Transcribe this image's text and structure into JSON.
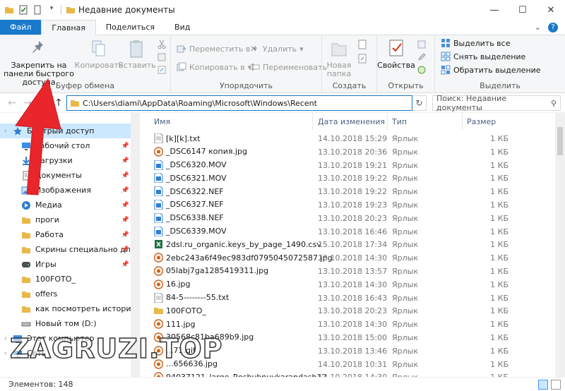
{
  "window": {
    "title": "Недавние документы",
    "minimize": "—",
    "maximize": "☐",
    "close": "✕"
  },
  "tabs": [
    {
      "label": "Файл"
    },
    {
      "label": "Главная"
    },
    {
      "label": "Поделиться"
    },
    {
      "label": "Вид"
    }
  ],
  "ribbon": {
    "clipboard": {
      "label": "Буфер обмена",
      "pin": "Закрепить на панели быстрого доступа",
      "copy": "Копировать",
      "paste": "Вставить"
    },
    "organize": {
      "label": "Упорядочить",
      "move_to": "Переместить в",
      "copy_to": "Копировать в",
      "delete": "Удалить",
      "rename": "Переименовать"
    },
    "create": {
      "label": "Создать",
      "new_folder": "Новая папка"
    },
    "open": {
      "label": "Открыть",
      "properties": "Свойства"
    },
    "select": {
      "label": "Выделить",
      "select_all": "Выделить все",
      "select_none": "Снять выделение",
      "invert": "Обратить выделение"
    }
  },
  "address": {
    "path": "C:\\Users\\diami\\AppData\\Roaming\\Microsoft\\Windows\\Recent",
    "search_placeholder": "Поиск: Недавние документы"
  },
  "nav": [
    {
      "label": "Быстрый доступ",
      "icon": "star-icon",
      "head": true,
      "selected": true
    },
    {
      "label": "Рабочий стол",
      "icon": "desktop-icon",
      "pinned": true
    },
    {
      "label": "Загрузки",
      "icon": "download-icon",
      "pinned": true
    },
    {
      "label": "Документы",
      "icon": "documents-icon",
      "pinned": true
    },
    {
      "label": "Изображения",
      "icon": "pictures-icon",
      "pinned": true
    },
    {
      "label": "Медиа",
      "icon": "media-icon",
      "pinned": true
    },
    {
      "label": "проги",
      "icon": "folder-icon",
      "pinned": true
    },
    {
      "label": "Работа",
      "icon": "folder-icon",
      "pinned": true
    },
    {
      "label": "Скрины специально для",
      "icon": "folder-icon",
      "pinned": true
    },
    {
      "label": "Игры",
      "icon": "games-icon",
      "pinned": true
    },
    {
      "label": "100FOTO_",
      "icon": "folder-icon"
    },
    {
      "label": "offers",
      "icon": "folder-icon"
    },
    {
      "label": "как посмотреть историю на",
      "icon": "folder-icon"
    },
    {
      "label": "Новый том (D:)",
      "icon": "drive-icon"
    },
    {
      "label": "Этот компьютер",
      "icon": "computer-icon",
      "head": true
    },
    {
      "label": "Сеть",
      "icon": "network-icon",
      "head": true
    }
  ],
  "columns": {
    "name": "Имя",
    "date": "Дата изменения",
    "type": "Тип",
    "size": "Размер"
  },
  "files": [
    {
      "name": "[k][k].txt",
      "date": "14.10.2018 15:29",
      "type": "Ярлык",
      "size": "1 КБ",
      "icon": "text"
    },
    {
      "name": "_DSC6147 копия.jpg",
      "date": "13.10.2018 20:36",
      "type": "Ярлык",
      "size": "1 КБ",
      "icon": "image"
    },
    {
      "name": "_DSC6320.MOV",
      "date": "13.10.2018 19:21",
      "type": "Ярлык",
      "size": "1 КБ",
      "icon": "media"
    },
    {
      "name": "_DSC6321.MOV",
      "date": "13.10.2018 19:22",
      "type": "Ярлык",
      "size": "1 КБ",
      "icon": "media"
    },
    {
      "name": "_DSC6322.NEF",
      "date": "13.10.2018 19:22",
      "type": "Ярлык",
      "size": "1 КБ",
      "icon": "media"
    },
    {
      "name": "_DSC6327.NEF",
      "date": "13.10.2018 19:23",
      "type": "Ярлык",
      "size": "1 КБ",
      "icon": "media"
    },
    {
      "name": "_DSC6338.NEF",
      "date": "13.10.2018 20:23",
      "type": "Ярлык",
      "size": "1 КБ",
      "icon": "media"
    },
    {
      "name": "_DSC6339.MOV",
      "date": "13.10.2018 16:46",
      "type": "Ярлык",
      "size": "1 КБ",
      "icon": "media"
    },
    {
      "name": "2dsl.ru_organic.keys_by_page_1490.csv",
      "date": "15.10.2018 17:34",
      "type": "Ярлык",
      "size": "1 КБ",
      "icon": "excel"
    },
    {
      "name": "2ebc243a6f49ec983df0795045072587.jpg",
      "date": "13.10.2018 14:30",
      "type": "Ярлык",
      "size": "1 КБ",
      "icon": "image"
    },
    {
      "name": "05labj7ga1285419311.jpg",
      "date": "13.10.2018 13:57",
      "type": "Ярлык",
      "size": "1 КБ",
      "icon": "image"
    },
    {
      "name": "16.jpg",
      "date": "13.10.2018 14:30",
      "type": "Ярлык",
      "size": "1 КБ",
      "icon": "image"
    },
    {
      "name": "84-5--------55.txt",
      "date": "13.10.2018 16:43",
      "type": "Ярлык",
      "size": "1 КБ",
      "icon": "text"
    },
    {
      "name": "100FOTO_",
      "date": "13.10.2018 20:23",
      "type": "Ярлык",
      "size": "1 КБ",
      "icon": "folder"
    },
    {
      "name": "111.jpg",
      "date": "13.10.2018 14:30",
      "type": "Ярлык",
      "size": "1 КБ",
      "icon": "image"
    },
    {
      "name": "30568c81ba689b9.jpg",
      "date": "13.10.2018 15:00",
      "type": "Ярлык",
      "size": "1 КБ",
      "icon": "image"
    },
    {
      "name": "...71.gif",
      "date": "13.10.2018 13:46",
      "type": "Ярлык",
      "size": "1 КБ",
      "icon": "image"
    },
    {
      "name": "...656636.jpg",
      "date": "14.10.2018 10:31",
      "type": "Ярлык",
      "size": "1 КБ",
      "icon": "image"
    },
    {
      "name": "94037121_large_Roshubnuykarandash12...",
      "date": "13.10.2018 14:30",
      "type": "Ярлык",
      "size": "1 КБ",
      "icon": "image"
    }
  ],
  "status": {
    "count": "Элементов: 148"
  },
  "watermark": "ZAGRUZI.TOP",
  "colors": {
    "accent": "#1979ca",
    "arrow": "#e8262b",
    "selection": "#cce8ff"
  }
}
